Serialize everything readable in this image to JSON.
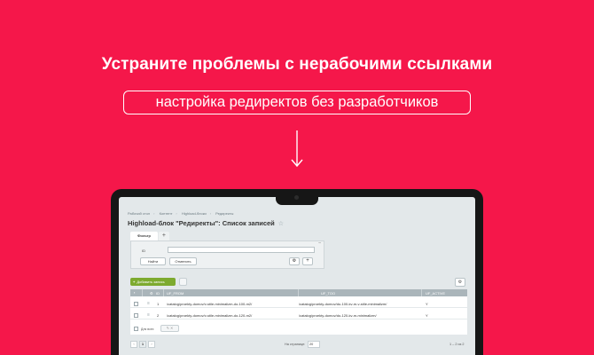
{
  "banner": {
    "headline": "Устраните проблемы с нерабочими ссылками",
    "subtitle": "настройка редиректов без разработчиков"
  },
  "colors": {
    "background": "#f5174a",
    "accent_button": "#7daa2f",
    "table_header": "#aab5ba"
  },
  "app": {
    "breadcrumbs": [
      "Рабочий стол",
      "Контент",
      "Highload-блоки",
      "Редиректы"
    ],
    "page_title": "Highload-блок \"Редиректы\": Список записей",
    "star": "☆",
    "filter": {
      "tab_label": "Фильтр",
      "add_tab": "+",
      "minimize": "–",
      "id_label": "ID",
      "id_value": "",
      "find_button": "Найти",
      "cancel_button": "Отменить",
      "settings_icon": "gear-icon",
      "add_icon": "+"
    },
    "toolbar": {
      "add_button": "Добавить запись",
      "add_icon": "+",
      "settings_icon": "⚙"
    },
    "table": {
      "columns": [
        "ID",
        "UF_FROM",
        "UF_TOO",
        "UF_ACTIVE"
      ],
      "rows": [
        {
          "id": "1",
          "from": "/catalog/proekty-domov/v-stile-minimalizm-do-100-m2/",
          "to": "/catalog/proekty-domov/do-100-kv-m-v-stile-minimalizm/",
          "active": "Y"
        },
        {
          "id": "2",
          "from": "/catalog/proekty-domov/v-stile-minimalizm-do-120-m2/",
          "to": "/catalog/proekty-domov/do-120-kv-m-minimalizm/",
          "active": "Y"
        }
      ],
      "footer_label": "Для всех",
      "footer_actions": "✎ ✕"
    },
    "pagination": {
      "prev": "‹",
      "current": "1",
      "next": "›",
      "per_page_label": "На странице:",
      "per_page_value": "20",
      "count": "1 – 2 из 2"
    }
  }
}
